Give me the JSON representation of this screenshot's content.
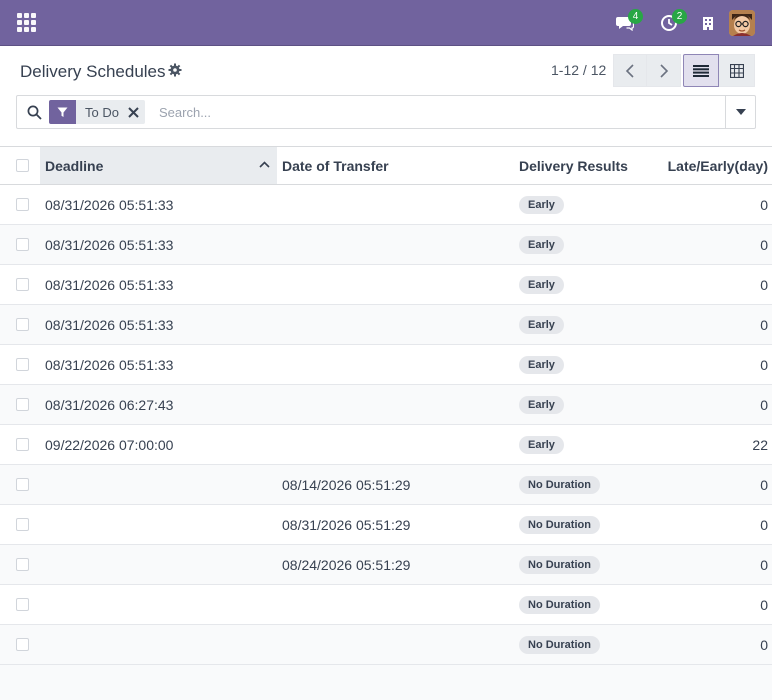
{
  "navbar": {
    "messages_count": "4",
    "activities_count": "2"
  },
  "control_panel": {
    "title": "Delivery Schedules",
    "pager": "1-12 / 12"
  },
  "search": {
    "facet_label": "To Do",
    "placeholder": "Search..."
  },
  "table": {
    "columns": [
      "Deadline",
      "Date of Transfer",
      "Delivery Results",
      "Late/Early(day)"
    ],
    "rows": [
      {
        "deadline": "08/31/2026 05:51:33",
        "transfer": "",
        "result": "Early",
        "days": "0"
      },
      {
        "deadline": "08/31/2026 05:51:33",
        "transfer": "",
        "result": "Early",
        "days": "0"
      },
      {
        "deadline": "08/31/2026 05:51:33",
        "transfer": "",
        "result": "Early",
        "days": "0"
      },
      {
        "deadline": "08/31/2026 05:51:33",
        "transfer": "",
        "result": "Early",
        "days": "0"
      },
      {
        "deadline": "08/31/2026 05:51:33",
        "transfer": "",
        "result": "Early",
        "days": "0"
      },
      {
        "deadline": "08/31/2026 06:27:43",
        "transfer": "",
        "result": "Early",
        "days": "0"
      },
      {
        "deadline": "09/22/2026 07:00:00",
        "transfer": "",
        "result": "Early",
        "days": "22"
      },
      {
        "deadline": "",
        "transfer": "08/14/2026 05:51:29",
        "result": "No Duration",
        "days": "0"
      },
      {
        "deadline": "",
        "transfer": "08/31/2026 05:51:29",
        "result": "No Duration",
        "days": "0"
      },
      {
        "deadline": "",
        "transfer": "08/24/2026 05:51:29",
        "result": "No Duration",
        "days": "0"
      },
      {
        "deadline": "",
        "transfer": "",
        "result": "No Duration",
        "days": "0"
      },
      {
        "deadline": "",
        "transfer": "",
        "result": "No Duration",
        "days": "0"
      }
    ]
  },
  "colors": {
    "brand": "#71639e",
    "badge": "#28a745"
  }
}
